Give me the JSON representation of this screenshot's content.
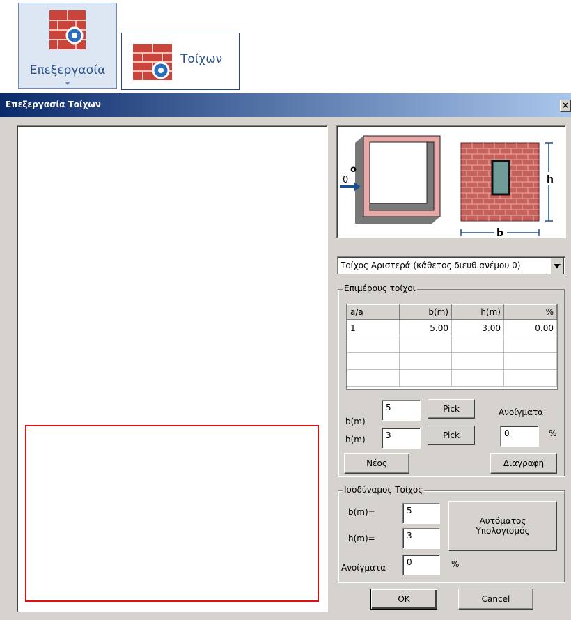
{
  "ribbon": {
    "edit_label": "Επεξεργασία",
    "walls_label": "Τοίχων"
  },
  "dialog": {
    "title": "Επεξεργασία Τοίχων",
    "close_glyph": "×"
  },
  "diagram": {
    "wind_label": "0",
    "origin_label": "o",
    "h_label": "h",
    "b_label": "b"
  },
  "wall_select": {
    "value": "Τοίχος Αριστερά (κάθετος διευθ.ανέμου 0)"
  },
  "subwalls": {
    "title": "Επιμέρους τοίχοι",
    "columns": [
      "a/a",
      "b(m)",
      "h(m)",
      "%"
    ],
    "rows": [
      [
        "1",
        "5.00",
        "3.00",
        "0.00"
      ]
    ],
    "b_label": "b(m)",
    "b_value": "5",
    "h_label": "h(m)",
    "h_value": "3",
    "pick_label": "Pick",
    "openings_label": "Ανοίγματα",
    "openings_value": "0",
    "percent": "%",
    "new_label": "Νέος",
    "delete_label": "Διαγραφή"
  },
  "equivalent": {
    "title": "Ισοδύναμος Τοίχος",
    "b_label": "b(m)=",
    "b_value": "5",
    "h_label": "h(m)=",
    "h_value": "3",
    "openings_label": "Ανοίγματα",
    "openings_value": "0",
    "percent": "%",
    "auto_line1": "Αυτόματος",
    "auto_line2": "Υπολογισμός"
  },
  "footer": {
    "ok_label": "OK",
    "cancel_label": "Cancel"
  },
  "colors": {
    "brick": "#c0504d",
    "title_start": "#0a2a6a",
    "title_end": "#a9c6ec",
    "accent_red": "#e01010"
  }
}
